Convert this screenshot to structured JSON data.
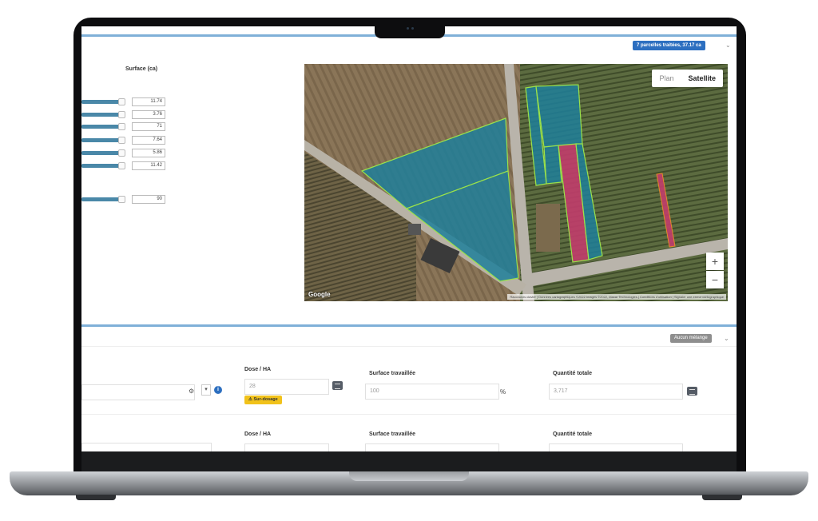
{
  "header": {
    "parcels_badge": "7 parcelles traitées, 37.17 ca"
  },
  "surface_panel": {
    "column_header": "Surface (ca)",
    "rows": [
      {
        "value": "11.74",
        "fill": 0.9
      },
      {
        "value": "3.76",
        "fill": 0.9
      },
      {
        "value": "71",
        "fill": 0.9
      },
      {
        "value": "7.64",
        "fill": 0.9
      },
      {
        "value": "5.86",
        "fill": 0.9
      },
      {
        "value": "11.42",
        "fill": 0.9
      },
      {
        "value": "90",
        "fill": 0.9
      }
    ]
  },
  "map": {
    "toggle_plan": "Plan",
    "toggle_satellite": "Satellite",
    "active_view": "Satellite",
    "zoom_in": "+",
    "zoom_out": "−",
    "provider": "Google",
    "attribution": "Raccourcis clavier | Données cartographiques ©2022 Images ©2022, Maxar Technologies | Conditions d'utilisation | Signaler une erreur cartographique",
    "colors": {
      "treated": "#1f7f9a",
      "selected": "#c13d6b",
      "outline": "#9be24a"
    }
  },
  "mix": {
    "mix_badge": "Aucun mélange"
  },
  "product_rows": [
    {
      "dose_label": "Dose / HA",
      "dose_value": "28",
      "warning": "Sur-dosage",
      "surface_label": "Surface travaillée",
      "surface_value": "100",
      "unit": "%",
      "total_label": "Quantité totale",
      "total_value": "3,717"
    },
    {
      "dose_label": "Dose / HA",
      "surface_label": "Surface travaillée",
      "total_label": "Quantité totale"
    }
  ],
  "icons": {
    "gear": "gear-icon",
    "info": "info-icon",
    "calculator": "calculator-icon",
    "warning": "warning-icon",
    "chevron": "chevron-down-icon"
  }
}
